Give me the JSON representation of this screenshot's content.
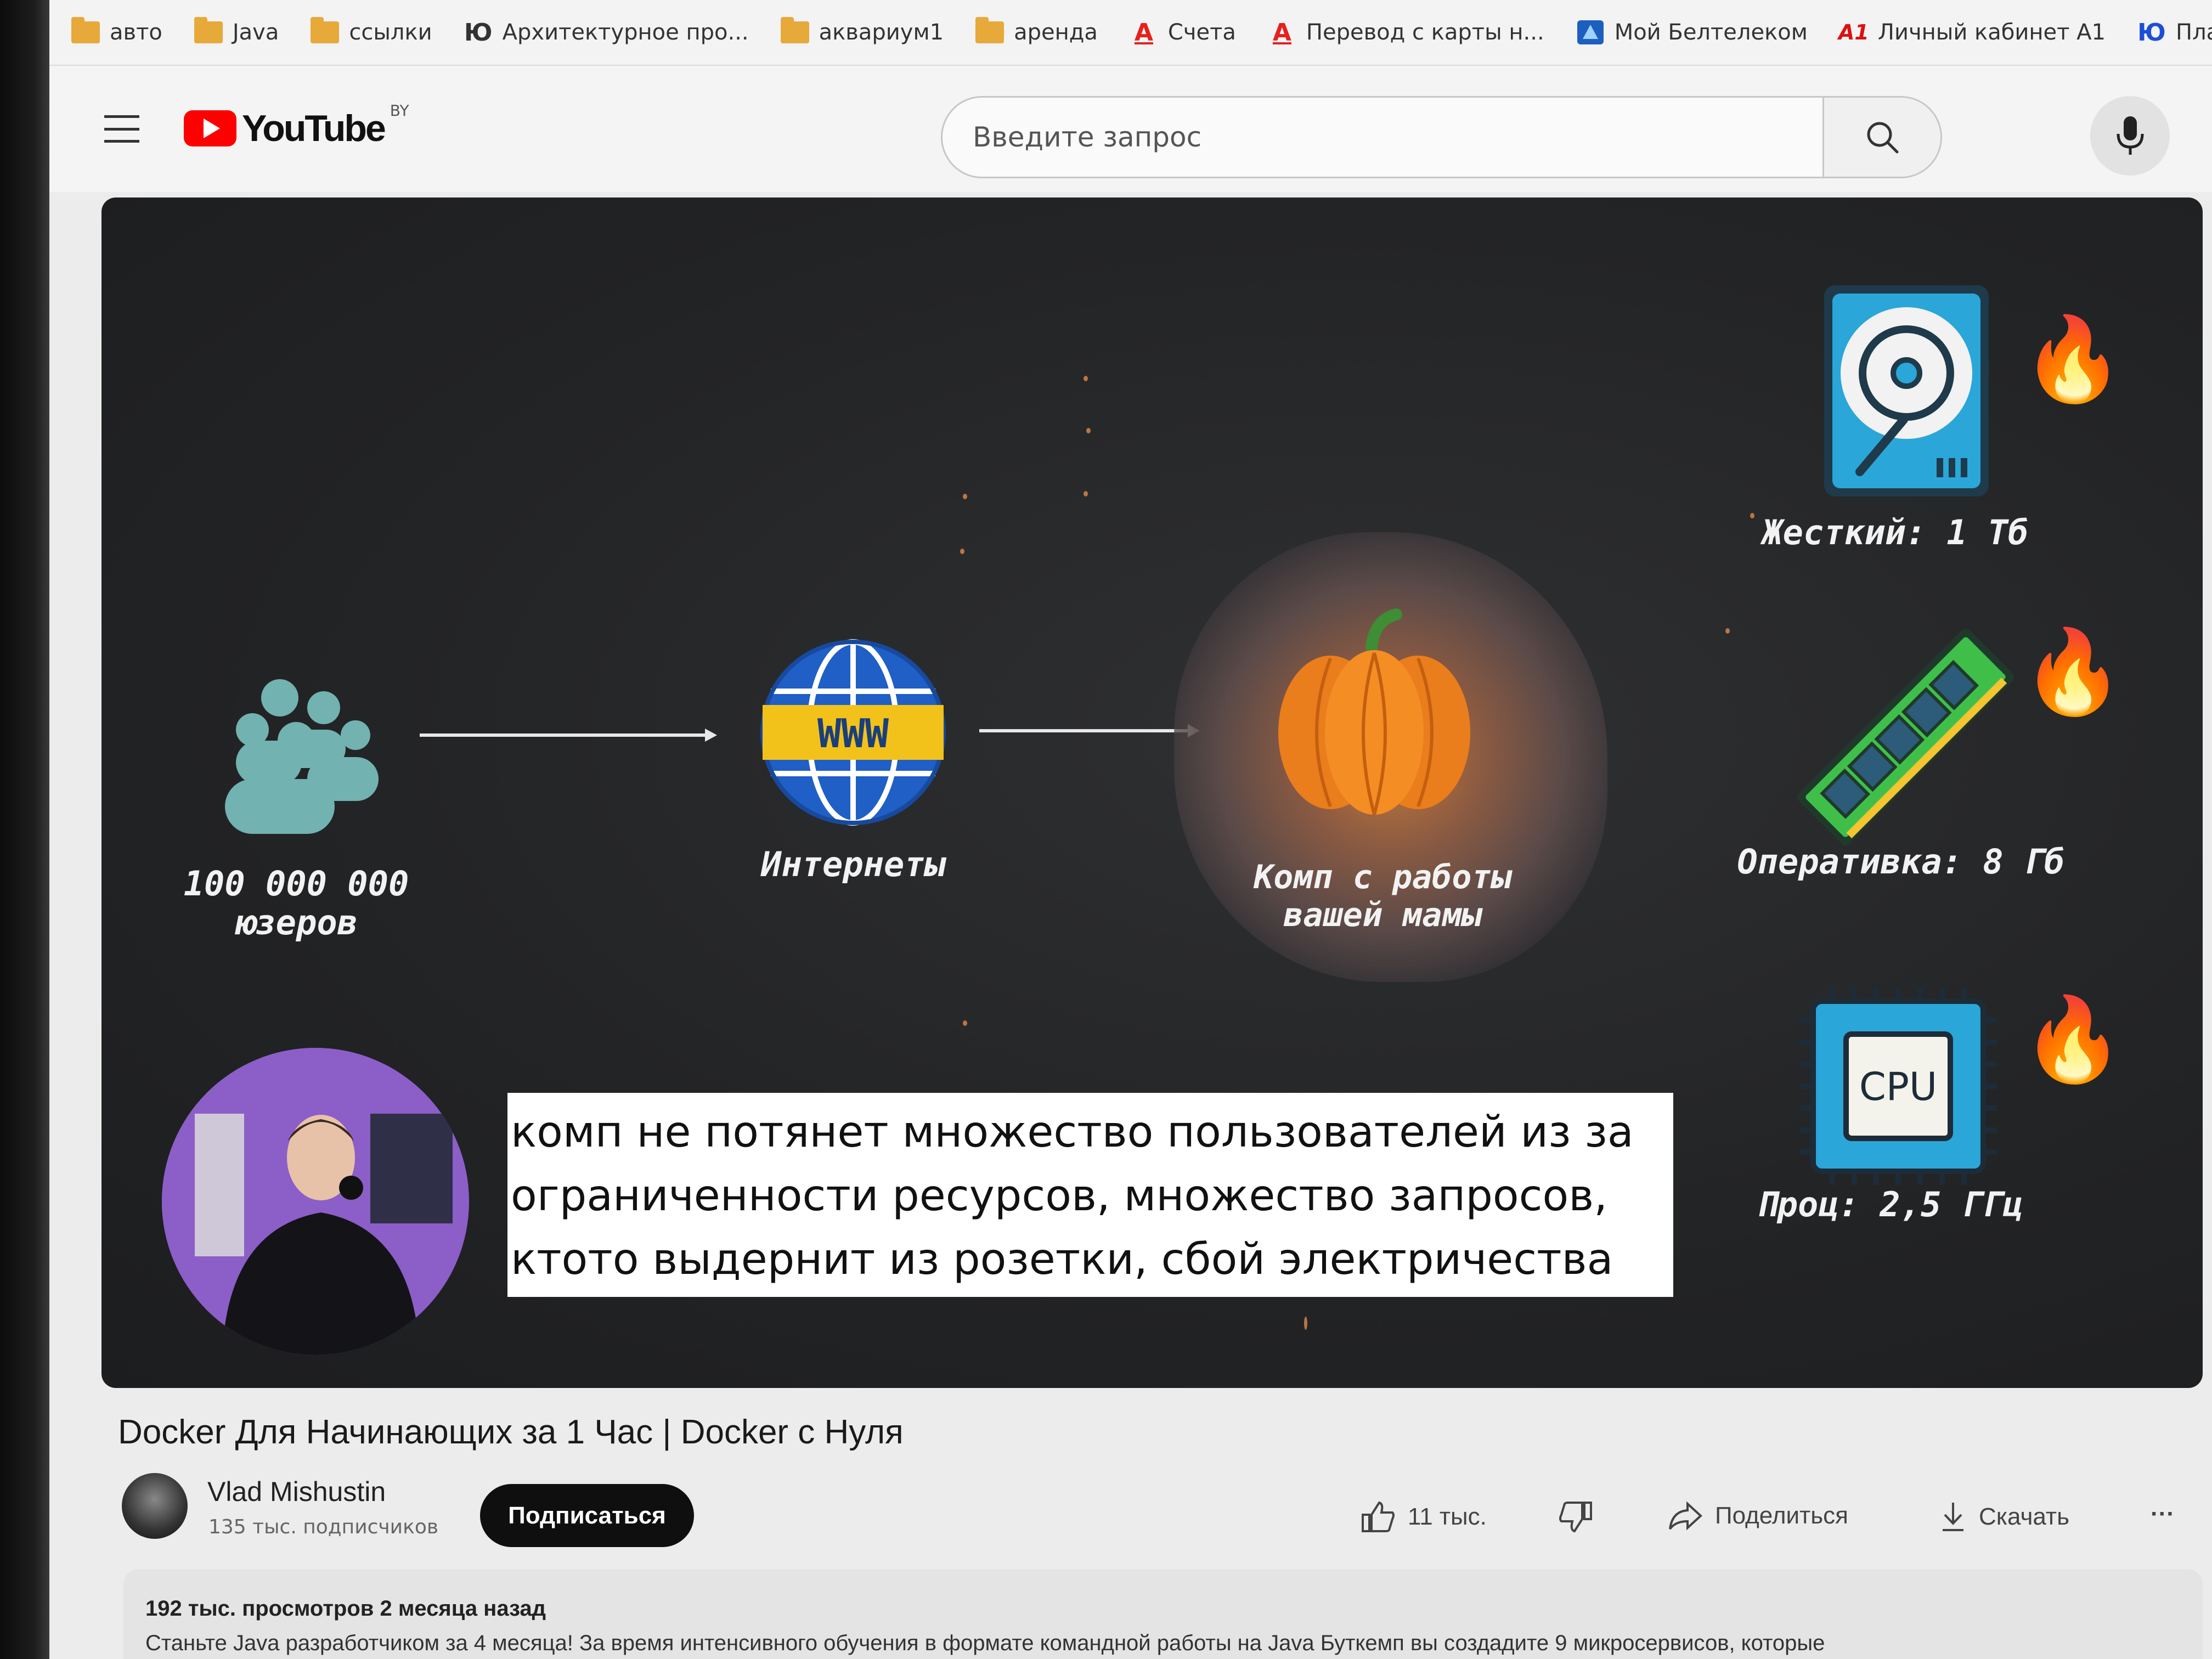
{
  "bookmarks": [
    {
      "label": "авто",
      "icon": "folder-icon"
    },
    {
      "label": "Java",
      "icon": "folder-icon"
    },
    {
      "label": "ссылки",
      "icon": "folder-icon"
    },
    {
      "label": "Архитектурное про...",
      "icon": "yu-logo-icon",
      "glyph": "Ю"
    },
    {
      "label": "аквариум1",
      "icon": "folder-icon"
    },
    {
      "label": "аренда",
      "icon": "folder-icon"
    },
    {
      "label": "Счета",
      "icon": "alfa-logo-icon",
      "glyph": "А"
    },
    {
      "label": "Перевод с карты н...",
      "icon": "alfa-logo-icon",
      "glyph": "А"
    },
    {
      "label": "Мой Белтелеком",
      "icon": "beltelecom-logo-icon"
    },
    {
      "label": "Личный кабинет А1",
      "icon": "a1-logo-icon",
      "glyph": "A1"
    },
    {
      "label": "Платежи и перевод",
      "icon": "yoomoney-logo-icon",
      "glyph": "Ю"
    }
  ],
  "header": {
    "logo_text": "YouTube",
    "region": "BY",
    "search_placeholder": "Введите запрос"
  },
  "slide": {
    "users_label_line1": "100 000 000",
    "users_label_line2": "юзеров",
    "internet_label": "Интернеты",
    "www_text": "WWW",
    "comp_label_line1": "Комп с работы",
    "comp_label_line2": "вашей мамы",
    "disk_label": "Жесткий: 1 Тб",
    "ram_label": "Оперативка: 8 Гб",
    "cpu_text": "CPU",
    "cpu_label": "Проц: 2,5 ГГц"
  },
  "subtitle": {
    "line1": "комп не потянет множество пользователей из за",
    "line2": "ограниченности ресурсов, множество запросов,",
    "line3": "ктото выдернит из розетки, сбой электричества"
  },
  "video": {
    "title": "Docker Для Начинающих за 1 Час | Docker с Нуля",
    "channel_name": "Vlad Mishustin",
    "channel_subs": "135 тыс. подписчиков",
    "subscribe_label": "Подписаться",
    "likes": "11 тыс.",
    "share_label": "Поделиться",
    "download_label": "Скачать",
    "more_label": "···"
  },
  "description": {
    "meta": "192 тыс. просмотров  2 месяца назад",
    "text": "Станьте Java разработчиком за 4 месяца! За время интенсивного обучения в формате командной работы на Java Буткемп вы создадите 9 микросервисов, которые"
  },
  "colors": {
    "youtube_red": "#ff0000",
    "folder": "#e7a93a",
    "accent_teal": "#6fb0b0",
    "slide_bg": "#232426"
  }
}
